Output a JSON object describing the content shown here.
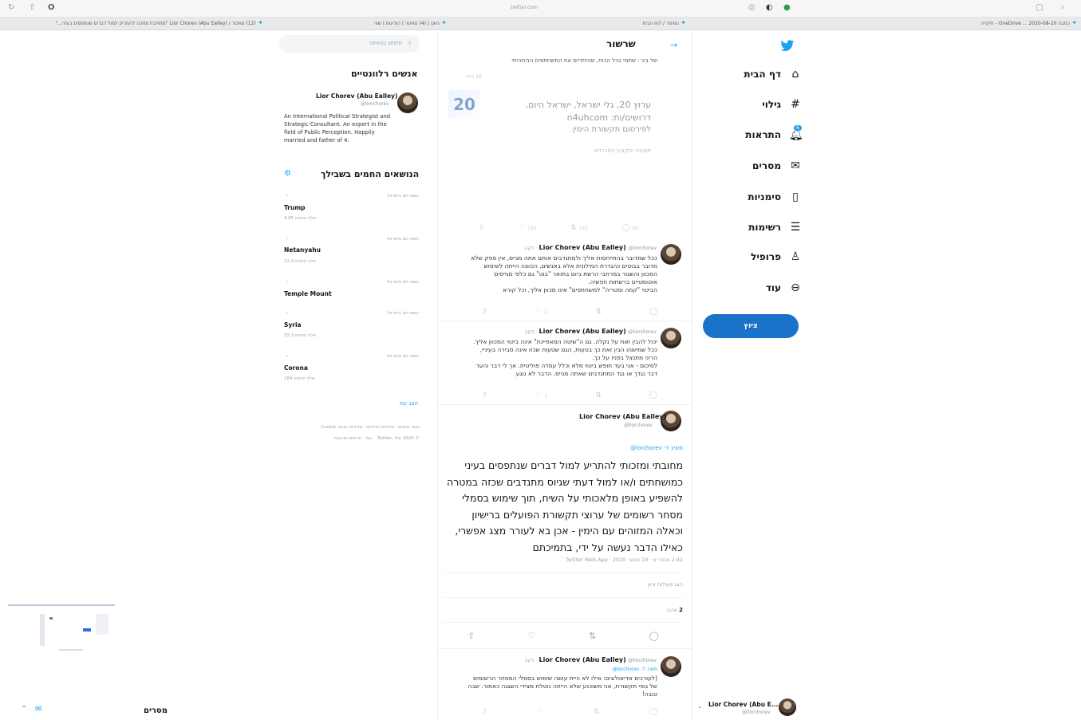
{
  "browser": {
    "url": "twitter.com",
    "tabs": [
      {
        "title": "כתבה 2020-08-20 ... OneDrive - תיקייה"
      },
      {
        "title": "טוויטר / לוח הבית"
      },
      {
        "title": "ניווט | (4) טוויטר | הודעות | שווי"
      },
      {
        "title": "(12) טוויטר / Lior Chorev (Abu Ealley) \"מחוייבת ומזכה להתריע למול דברים שנתפסים בעיני...\""
      }
    ]
  },
  "colors": {
    "brand": "#1da1f2",
    "tweet_button": "#1a73c9",
    "muted": "#8a969f"
  },
  "nav": {
    "logo": "twitter-bird-icon",
    "items": [
      {
        "label": "דף הבית",
        "icon": "home-icon"
      },
      {
        "label": "גילוי",
        "icon": "hashtag-icon"
      },
      {
        "label": "התראות",
        "icon": "bell-icon",
        "badge": "6"
      },
      {
        "label": "מסרים",
        "icon": "envelope-icon"
      },
      {
        "label": "סימניות",
        "icon": "bookmark-icon"
      },
      {
        "label": "רשימות",
        "icon": "list-icon"
      },
      {
        "label": "פרופיל",
        "icon": "person-icon"
      },
      {
        "label": "עוד",
        "icon": "more-icon"
      }
    ],
    "tweet_button": "ציוץ",
    "account_name": "Lior Chorev (Abu E...",
    "account_handle": "@liorchorev"
  },
  "thread": {
    "header_title": "שרשור",
    "top_text": "של בינ׳: שתמי בכל הכוח, שהיחדיים את המשחתפים הביתהיחי",
    "promo": {
      "line1": "ערוץ 20, גלי ישראל, ישראל היום,",
      "line2": "דרושים/ות: n4uhcom",
      "line3": "לפירסום תקשורת הימין",
      "meta": "תפוצה ותקציב המכרזים",
      "time": "16 ביולי",
      "counts": {
        "replies": "90",
        "retweets": "145",
        "likes": "530"
      }
    },
    "tweets": [
      {
        "name": "Lior Chorev (Abu Ealley)",
        "handle": "@liorchorev",
        "time": "דקה",
        "lines": [
          "ככל שמדובר בהתייחסות אליך ולמתנדבים אותם אתה מגייס, אין ספק שלא",
          "מדובר בבוטים כהגדרת המילונית אלא באנשים. הכוונה הייתה לשימוש",
          "המכוון והשגור במרחבי הרשת ביום בתואר \"בוט\" גם כלפי מגייסים",
          "אוטומטיים ברשתות חפשיה.",
          "הביטוי \"קמה וסטריה\" למשחתפים\" אינו מכוון אליך, וכל קורא"
        ],
        "likes": "1"
      },
      {
        "name": "Lior Chorev (Abu Ealley)",
        "handle": "@liorchorev",
        "time": "דקה",
        "lines": [
          "יכול להבין זאת על נקלה. גם ה\"שיטה המאפיינת\" אינה ביטוי המכוון אליך.",
          "ככל שמישהו הבין זאת כך בטעות, הגם שטעות שכזו אינה סבירה בעיניי,",
          "הריני מתנצל בפניו על כך.",
          "לסיכום - אני בעד חופש ביטוי מלא וכלל עמדה פוליטית. אך לי דבר והער",
          "דבר נגדך או נגד המתנדבים שאתה מגייס. הדבר לא נוגע"
        ],
        "likes": "1"
      }
    ],
    "main_tweet": {
      "name": "Lior Chorev (Abu Ealley)",
      "handle": "@liorchorev",
      "reply_to": "משיב ל- lorchorev@",
      "text": "מחובתי ומזכותי להתריע למול דברים שנתפסים בעיני כמושחתים ו/או למול דעתי שגיוס מתנדבים שכזה במטרה להשפיע באופן מלאכותי על השיח, תוך שימוש בסמלי מסחר רשומים של ערוצי תקשורת הפועלים ברישיון וכאלה המזוהים עם הימין - אכן בא לעורר מצג אפשרי, כאילו הדבר נעשה על ידי, בתמיכתם",
      "meta": "2:42 אחה״צ · 19 באוג׳ 2020 · Twitter Web App",
      "activity": "הצג פעילות ציוץ",
      "likes_count": "2",
      "likes_label": "אהבו"
    },
    "reply": {
      "name": "Lior Chorev (Abu Ealley)",
      "handle": "@liorchorev",
      "time": "דקה",
      "reply_to": "משיב ל- lorchorev@",
      "lines": [
        "(לעורכים אדיאולוגים: אילו לא היית עושה שימוש בסמלי המסחר הרשומים",
        "של גופי תקשורת, אני משוכנע שלא הייתה נוטלת מצידי השגגה כאמור. שבה",
        "טובה!"
      ]
    }
  },
  "right": {
    "search_placeholder": "חיפוש בטוויטר",
    "people_title": "אנשים רלוונטיים",
    "person_name": "Lior Chorev (Abu Ealley)",
    "person_handle": "@liorchorev",
    "person_bio": [
      "An International Political Strategist and",
      "Strategic Consultant. An expert in the",
      "field of Public Perception. Happily",
      "married and father of 4."
    ],
    "trends_title": "הנושאים החמים בשבילך",
    "trends": [
      {
        "meta": "נושא חם בישראל",
        "name": "Trump",
        "count": "4.65 אלף ציוצים"
      },
      {
        "meta": "נושא חם בישראל",
        "name": "Netanyahu",
        "count": "12.4 אלף ציוצים"
      },
      {
        "meta": "נושא חם בישראל",
        "name": "Temple Mount",
        "count": ""
      },
      {
        "meta": "נושא חם בישראל",
        "name": "Syria",
        "count": "33.3 אלף ציוצים"
      },
      {
        "meta": "נושא חם בישראל",
        "name": "Corona",
        "count": "184 אלף ציוצים"
      }
    ],
    "show_more": "הצג עוד",
    "footer1": "תנאי שימוש · מדיניות פרטיות · מדיניות קובצי Cookie",
    "footer2": "© 2020 Twitter, Inc. · עוד · פרסום מודעות"
  },
  "dm_bar": {
    "label": "מסרים"
  }
}
